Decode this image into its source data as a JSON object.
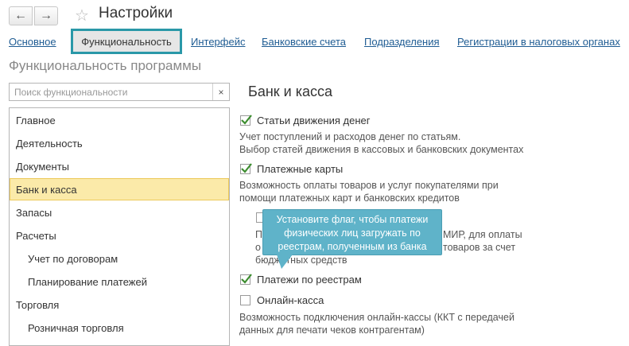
{
  "header": {
    "back_icon": "arrow-left-icon",
    "forward_icon": "arrow-right-icon",
    "favorite_icon": "star-icon",
    "title": "Настройки"
  },
  "tabs": [
    {
      "label": "Основное",
      "active": false
    },
    {
      "label": "Функциональность",
      "active": true
    },
    {
      "label": "Интерфейс",
      "active": false
    },
    {
      "label": "Банковские счета",
      "active": false
    },
    {
      "label": "Подразделения",
      "active": false
    },
    {
      "label": "Регистрации в налоговых органах",
      "active": false
    }
  ],
  "section_title": "Функциональность программы",
  "search": {
    "placeholder": "Поиск функциональности",
    "value": "",
    "clear_label": "×"
  },
  "list": [
    {
      "label": "Главное",
      "indent": 0,
      "selected": false
    },
    {
      "label": "Деятельность",
      "indent": 0,
      "selected": false
    },
    {
      "label": "Документы",
      "indent": 0,
      "selected": false
    },
    {
      "label": "Банк и касса",
      "indent": 0,
      "selected": true
    },
    {
      "label": "Запасы",
      "indent": 0,
      "selected": false
    },
    {
      "label": "Расчеты",
      "indent": 0,
      "selected": false
    },
    {
      "label": "Учет по договорам",
      "indent": 1,
      "selected": false
    },
    {
      "label": "Планирование платежей",
      "indent": 1,
      "selected": false
    },
    {
      "label": "Торговля",
      "indent": 0,
      "selected": false
    },
    {
      "label": "Розничная торговля",
      "indent": 1,
      "selected": false
    }
  ],
  "right": {
    "title": "Банк и касса",
    "options": [
      {
        "label": "Статьи движения денег",
        "checked": true,
        "description": [
          "Учет поступлений и расходов денег по статьям.",
          "Выбор статей движения в кассовых и банковских документах"
        ]
      },
      {
        "label": "Платежные карты",
        "checked": true,
        "description": [
          "Возможность оплаты товаров и услуг покупателями при",
          "помощи платежных карт и банковских кредитов"
        ]
      },
      {
        "label": "",
        "checked": false,
        "description": [
          "П",
          "МИР, для оплаты",
          "о",
          "товаров за счет",
          "бюджетных средств"
        ]
      },
      {
        "label": "Платежи по реестрам",
        "checked": true,
        "description": []
      },
      {
        "label": "Онлайн-касса",
        "checked": false,
        "description": [
          "Возможность подключения онлайн-кассы (ККТ с передачей",
          "данных для печати чеков контрагентам)"
        ]
      }
    ]
  },
  "tooltip": {
    "lines": [
      "Установите флаг, чтобы платежи",
      "физических лиц загружать по",
      "реестрам, полученным из банка"
    ]
  },
  "colors": {
    "accent_border": "#2a98a8",
    "link": "#1f5c93",
    "selected_bg": "#fbeaa9",
    "tooltip_bg": "#5fb3c9",
    "check": "#3c8d2f"
  }
}
